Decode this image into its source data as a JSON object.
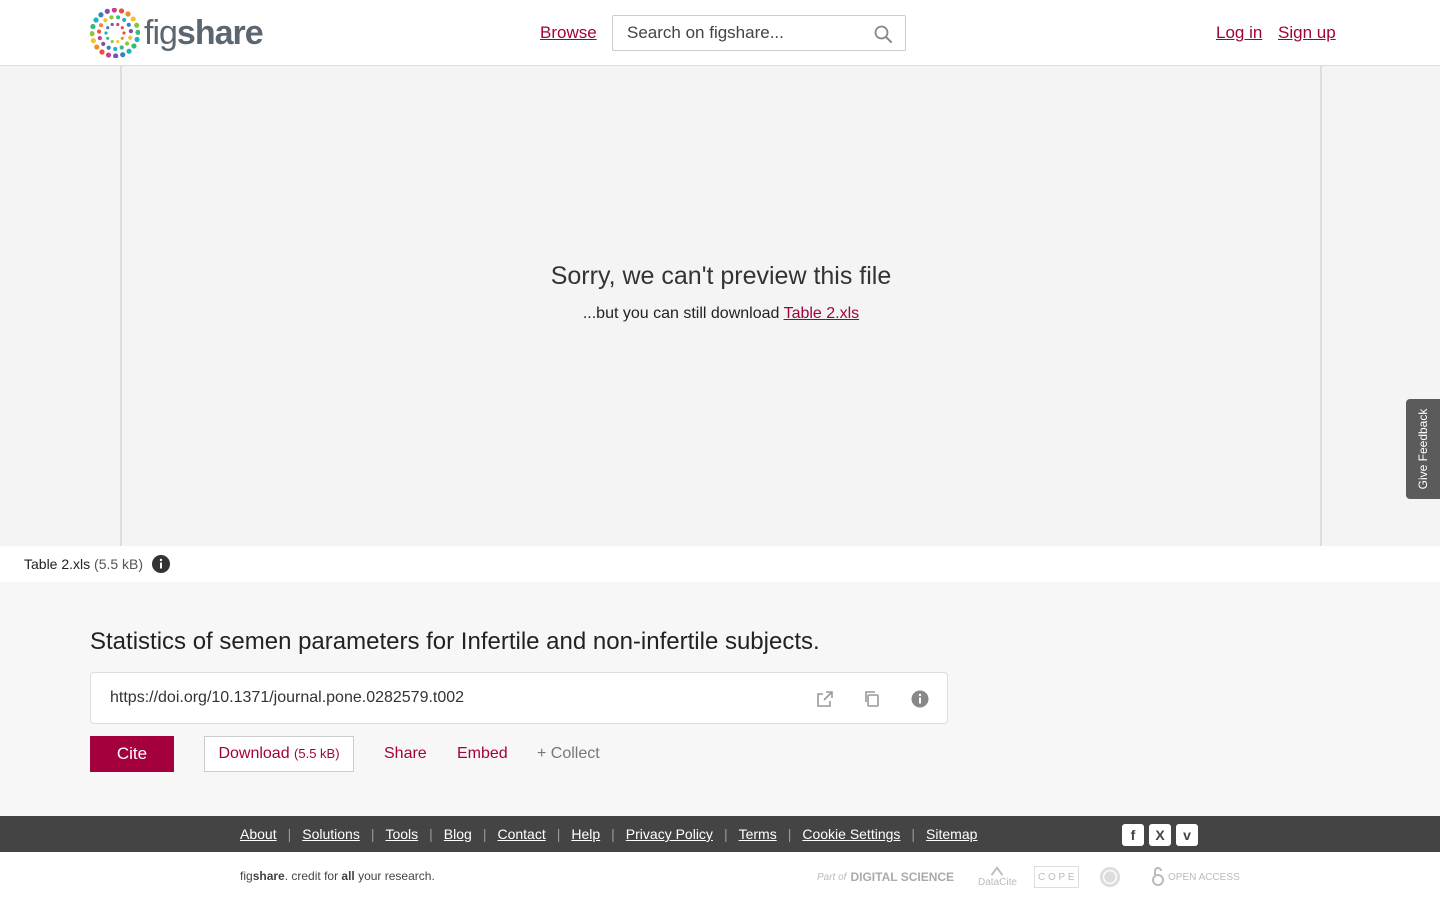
{
  "header": {
    "logo_fig": "fig",
    "logo_share": "share",
    "browse": "Browse",
    "search_placeholder": "Search on figshare...",
    "login": "Log in",
    "signup": "Sign up"
  },
  "preview": {
    "title": "Sorry, we can't preview this file",
    "subtitle": "...but you can still download",
    "file_link": "Table 2.xls"
  },
  "feedback": "Give Feedback",
  "file": {
    "name": "Table 2.xls",
    "size": "(5.5 kB)"
  },
  "item": {
    "title": "Statistics of semen parameters for Infertile and non-infertile subjects.",
    "doi": "https://doi.org/10.1371/journal.pone.0282579.t002"
  },
  "actions": {
    "cite": "Cite",
    "download": "Download",
    "download_size": "(5.5 kB)",
    "share": "Share",
    "embed": "Embed",
    "collect": "+ Collect"
  },
  "footer": {
    "links": [
      "About",
      "Solutions",
      "Tools",
      "Blog",
      "Contact",
      "Help",
      "Privacy Policy",
      "Terms",
      "Cookie Settings",
      "Sitemap"
    ],
    "social": [
      "f",
      "X",
      "v"
    ],
    "tagline_fig": "fig",
    "tagline_share": "share",
    "tagline_mid": ". credit for ",
    "tagline_all": "all",
    "tagline_end": " your research.",
    "partners": {
      "digital_science_prefix": "Part of",
      "digital_science": "DIGITAL SCIENCE",
      "datacite": "DataCite",
      "cope": "C O P E",
      "open_access": "OPEN ACCESS"
    }
  },
  "colors": {
    "accent": "#a4003e",
    "footer_dark": "#444444",
    "preview_bg": "#f4f4f4"
  }
}
